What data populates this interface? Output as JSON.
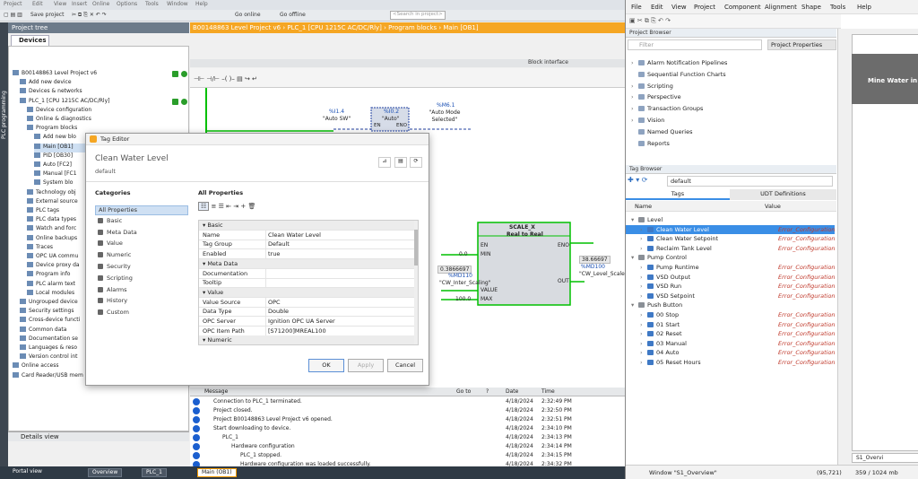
{
  "tia": {
    "menu": [
      "Project",
      "Edit",
      "View",
      "Insert",
      "Online",
      "Options",
      "Tools",
      "Window",
      "Help"
    ],
    "toolbar": {
      "save": "Save project",
      "go_online": "Go online",
      "go_offline": "Go offline",
      "search_placeholder": "<Search in project>"
    },
    "project_tree_title": "Project tree",
    "devices_tab": "Devices",
    "portal_label": "PLC programming",
    "tree": [
      {
        "label": "B00148863 Level Project v6",
        "indent": 0
      },
      {
        "label": "Add new device",
        "indent": 1
      },
      {
        "label": "Devices & networks",
        "indent": 1
      },
      {
        "label": "PLC_1 [CPU 1215C AC/DC/Rly]",
        "indent": 1
      },
      {
        "label": "Device configuration",
        "indent": 2
      },
      {
        "label": "Online & diagnostics",
        "indent": 2
      },
      {
        "label": "Program blocks",
        "indent": 2
      },
      {
        "label": "Add new blo",
        "indent": 3
      },
      {
        "label": "Main [OB1]",
        "indent": 3
      },
      {
        "label": "PID [OB30]",
        "indent": 3
      },
      {
        "label": "Auto [FC2]",
        "indent": 3
      },
      {
        "label": "Manual [FC1",
        "indent": 3
      },
      {
        "label": "System blo",
        "indent": 3
      },
      {
        "label": "Technology obj",
        "indent": 2
      },
      {
        "label": "External source",
        "indent": 2
      },
      {
        "label": "PLC tags",
        "indent": 2
      },
      {
        "label": "PLC data types",
        "indent": 2
      },
      {
        "label": "Watch and forc",
        "indent": 2
      },
      {
        "label": "Online backups",
        "indent": 2
      },
      {
        "label": "Traces",
        "indent": 2
      },
      {
        "label": "OPC UA commu",
        "indent": 2
      },
      {
        "label": "Device proxy da",
        "indent": 2
      },
      {
        "label": "Program info",
        "indent": 2
      },
      {
        "label": "PLC alarm text",
        "indent": 2
      },
      {
        "label": "Local modules",
        "indent": 2
      },
      {
        "label": "Ungrouped device",
        "indent": 1
      },
      {
        "label": "Security settings",
        "indent": 1
      },
      {
        "label": "Cross-device functi",
        "indent": 1
      },
      {
        "label": "Common data",
        "indent": 1
      },
      {
        "label": "Documentation se",
        "indent": 1
      },
      {
        "label": "Languages & reso",
        "indent": 1
      },
      {
        "label": "Version control int",
        "indent": 1
      },
      {
        "label": "Online access",
        "indent": 0
      },
      {
        "label": "Card Reader/USB mem",
        "indent": 0
      }
    ],
    "details_view": "Details view",
    "taskbar": {
      "portal": "Portal view",
      "overview": "Overview",
      "plc": "PLC_1",
      "main": "Main (OB1)"
    },
    "editor_title": "B00148863 Level Project v6 › PLC_1 [CPU 1215C AC/DC/Rly] › Program blocks › Main [OB1]",
    "block_interface": "Block interface",
    "ladder": {
      "c1_addr": "%I1.4",
      "c1_name": "\"Auto SW\"",
      "c2_addr": "%I0.2",
      "c2_name": "\"Auto\"",
      "coil_addr": "%M6.1",
      "coil_name": "\"Auto Mode Selected\"",
      "en": "EN",
      "eno": "ENO",
      "fb_title": "SCALE_X",
      "fb_sub": "Real to Real",
      "min_val": "0.0",
      "min": "MIN",
      "value_cur": "0.3866697",
      "value_addr": "%MD110",
      "value_name": "\"CW_Inter_Scaling\"",
      "value": "VALUE",
      "max_val": "100.0",
      "max": "MAX",
      "out": "OUT",
      "out_cur": "38.66697",
      "out_addr": "%MD100",
      "out_name": "\"CW_Level_Scaled\""
    },
    "messages": {
      "headers": {
        "message": "Message",
        "goto": "Go to",
        "q": "?",
        "date": "Date",
        "time": "Time"
      },
      "rows": [
        {
          "text": "Connection to PLC_1 terminated.",
          "indent": 0,
          "date": "4/18/2024",
          "time": "2:32:49 PM"
        },
        {
          "text": "Project closed.",
          "indent": 0,
          "date": "4/18/2024",
          "time": "2:32:50 PM"
        },
        {
          "text": "Project B00148863 Level Project v6 opened.",
          "indent": 0,
          "date": "4/18/2024",
          "time": "2:32:51 PM"
        },
        {
          "text": "Start downloading to device.",
          "indent": 0,
          "date": "4/18/2024",
          "time": "2:34:10 PM"
        },
        {
          "text": "PLC_1",
          "indent": 1,
          "date": "4/18/2024",
          "time": "2:34:13 PM"
        },
        {
          "text": "Hardware configuration",
          "indent": 2,
          "date": "4/18/2024",
          "time": "2:34:14 PM"
        },
        {
          "text": "PLC_1 stopped.",
          "indent": 3,
          "date": "4/18/2024",
          "time": "2:34:15 PM"
        },
        {
          "text": "Hardware configuration was loaded successfully.",
          "indent": 3,
          "date": "4/18/2024",
          "time": "2:34:32 PM"
        }
      ]
    }
  },
  "dialog": {
    "title": "Tag Editor",
    "tag_name": "Clean Water Level",
    "provider": "default",
    "categories_title": "Categories",
    "categories": [
      "All Properties",
      "Basic",
      "Meta Data",
      "Value",
      "Numeric",
      "Security",
      "Scripting",
      "Alarms",
      "History",
      "Custom"
    ],
    "all_props_title": "All Properties",
    "props": [
      {
        "k": "Basic",
        "sec": true
      },
      {
        "k": "Name",
        "v": "Clean Water Level"
      },
      {
        "k": "Tag Group",
        "v": "Default"
      },
      {
        "k": "Enabled",
        "v": "true"
      },
      {
        "k": "Meta Data",
        "sec": true
      },
      {
        "k": "Documentation",
        "v": ""
      },
      {
        "k": "Tooltip",
        "v": ""
      },
      {
        "k": "Value",
        "sec": true
      },
      {
        "k": "Value Source",
        "v": "OPC"
      },
      {
        "k": "Data Type",
        "v": "Double"
      },
      {
        "k": "OPC Server",
        "v": "Ignition OPC UA Server"
      },
      {
        "k": "OPC Item Path",
        "v": "[S71200]MREAL100"
      },
      {
        "k": "Numeric",
        "sec": true
      }
    ],
    "ok": "OK",
    "apply": "Apply",
    "cancel": "Cancel"
  },
  "designer": {
    "menu": [
      "File",
      "Edit",
      "View",
      "Project",
      "Component",
      "Alignment",
      "Shape",
      "Tools",
      "Help"
    ],
    "project_browser": "Project Browser",
    "filter_placeholder": "Filter",
    "project_properties": "Project Properties",
    "browser_items": [
      "Alarm Notification Pipelines",
      "Sequential Function Charts",
      "Scripting",
      "Perspective",
      "Transaction Groups",
      "Vision",
      "Named Queries",
      "Reports"
    ],
    "tag_browser": "Tag Browser",
    "provider": "default",
    "tabs": {
      "tags": "Tags",
      "udt": "UDT Definitions"
    },
    "columns": {
      "name": "Name",
      "value": "Value"
    },
    "tags": [
      {
        "name": "Level",
        "folder": true,
        "indent": 0,
        "val": ""
      },
      {
        "name": "Clean Water Level",
        "folder": false,
        "indent": 1,
        "val": "Error_Configuration",
        "sel": true
      },
      {
        "name": "Clean Water Setpoint",
        "folder": false,
        "indent": 1,
        "val": "Error_Configuration"
      },
      {
        "name": "Reclaim Tank Level",
        "folder": false,
        "indent": 1,
        "val": "Error_Configuration"
      },
      {
        "name": "Pump Control",
        "folder": true,
        "indent": 0,
        "val": ""
      },
      {
        "name": "Pump Runtime",
        "folder": false,
        "indent": 1,
        "val": "Error_Configuration"
      },
      {
        "name": "VSD Output",
        "folder": false,
        "indent": 1,
        "val": "Error_Configuration"
      },
      {
        "name": "VSD Run",
        "folder": false,
        "indent": 1,
        "val": "Error_Configuration"
      },
      {
        "name": "VSD Setpoint",
        "folder": false,
        "indent": 1,
        "val": "Error_Configuration"
      },
      {
        "name": "Push Button",
        "folder": true,
        "indent": 0,
        "val": ""
      },
      {
        "name": "00 Stop",
        "folder": false,
        "indent": 1,
        "val": "Error_Configuration"
      },
      {
        "name": "01 Start",
        "folder": false,
        "indent": 1,
        "val": "Error_Configuration"
      },
      {
        "name": "02 Reset",
        "folder": false,
        "indent": 1,
        "val": "Error_Configuration"
      },
      {
        "name": "03 Manual",
        "folder": false,
        "indent": 1,
        "val": "Error_Configuration"
      },
      {
        "name": "04 Auto",
        "folder": false,
        "indent": 1,
        "val": "Error_Configuration"
      },
      {
        "name": "05 Reset Hours",
        "folder": false,
        "indent": 1,
        "val": "Error_Configuration"
      }
    ],
    "window_header": "Mine Water in",
    "window_tab": "S1_Overvi",
    "status": {
      "window": "Window \"S1_Overview\"",
      "coords": "(95,721)",
      "memory": "359 / 1024 mb"
    }
  }
}
